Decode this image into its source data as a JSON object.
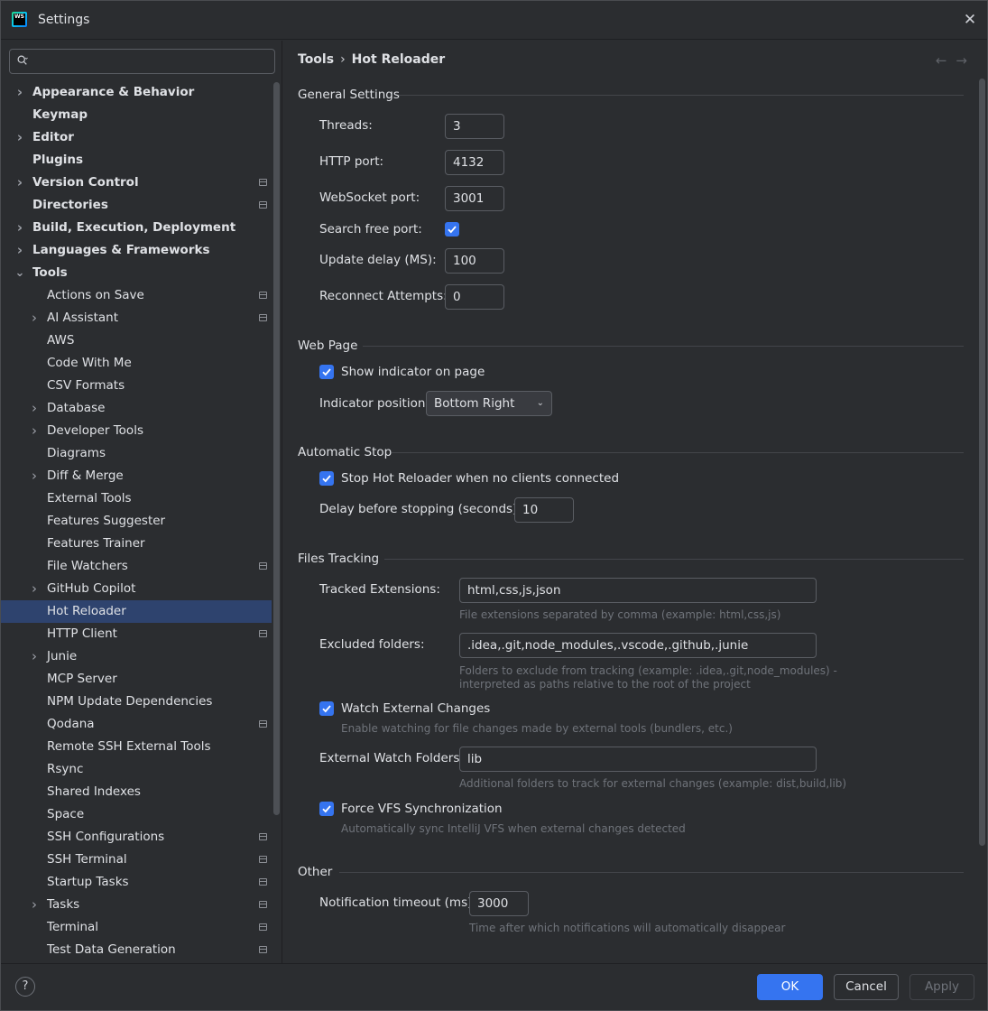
{
  "window": {
    "title": "Settings",
    "app_icon_text": "WS"
  },
  "sidebar": {
    "search": {
      "placeholder": ""
    },
    "items": [
      {
        "label": "Appearance & Behavior",
        "level": 0,
        "bold": true,
        "expandable": true,
        "expanded": false,
        "project": false
      },
      {
        "label": "Keymap",
        "level": 0,
        "bold": true,
        "expandable": false,
        "project": false
      },
      {
        "label": "Editor",
        "level": 0,
        "bold": true,
        "expandable": true,
        "expanded": false,
        "project": false
      },
      {
        "label": "Plugins",
        "level": 0,
        "bold": true,
        "expandable": false,
        "project": false
      },
      {
        "label": "Version Control",
        "level": 0,
        "bold": true,
        "expandable": true,
        "expanded": false,
        "project": true
      },
      {
        "label": "Directories",
        "level": 0,
        "bold": true,
        "expandable": false,
        "project": true
      },
      {
        "label": "Build, Execution, Deployment",
        "level": 0,
        "bold": true,
        "expandable": true,
        "expanded": false,
        "project": false
      },
      {
        "label": "Languages & Frameworks",
        "level": 0,
        "bold": true,
        "expandable": true,
        "expanded": false,
        "project": false
      },
      {
        "label": "Tools",
        "level": 0,
        "bold": true,
        "expandable": true,
        "expanded": true,
        "project": false
      },
      {
        "label": "Actions on Save",
        "level": 1,
        "expandable": false,
        "project": true
      },
      {
        "label": "AI Assistant",
        "level": 1,
        "expandable": true,
        "expanded": false,
        "project": true
      },
      {
        "label": "AWS",
        "level": 1,
        "expandable": false,
        "project": false
      },
      {
        "label": "Code With Me",
        "level": 1,
        "expandable": false,
        "project": false
      },
      {
        "label": "CSV Formats",
        "level": 1,
        "expandable": false,
        "project": false
      },
      {
        "label": "Database",
        "level": 1,
        "expandable": true,
        "expanded": false,
        "project": false
      },
      {
        "label": "Developer Tools",
        "level": 1,
        "expandable": true,
        "expanded": false,
        "project": false
      },
      {
        "label": "Diagrams",
        "level": 1,
        "expandable": false,
        "project": false
      },
      {
        "label": "Diff & Merge",
        "level": 1,
        "expandable": true,
        "expanded": false,
        "project": false
      },
      {
        "label": "External Tools",
        "level": 1,
        "expandable": false,
        "project": false
      },
      {
        "label": "Features Suggester",
        "level": 1,
        "expandable": false,
        "project": false
      },
      {
        "label": "Features Trainer",
        "level": 1,
        "expandable": false,
        "project": false
      },
      {
        "label": "File Watchers",
        "level": 1,
        "expandable": false,
        "project": true
      },
      {
        "label": "GitHub Copilot",
        "level": 1,
        "expandable": true,
        "expanded": false,
        "project": false
      },
      {
        "label": "Hot Reloader",
        "level": 1,
        "expandable": false,
        "project": false,
        "selected": true
      },
      {
        "label": "HTTP Client",
        "level": 1,
        "expandable": false,
        "project": true
      },
      {
        "label": "Junie",
        "level": 1,
        "expandable": true,
        "expanded": false,
        "project": false
      },
      {
        "label": "MCP Server",
        "level": 1,
        "expandable": false,
        "project": false
      },
      {
        "label": "NPM Update Dependencies",
        "level": 1,
        "expandable": false,
        "project": false
      },
      {
        "label": "Qodana",
        "level": 1,
        "expandable": false,
        "project": true
      },
      {
        "label": "Remote SSH External Tools",
        "level": 1,
        "expandable": false,
        "project": false
      },
      {
        "label": "Rsync",
        "level": 1,
        "expandable": false,
        "project": false
      },
      {
        "label": "Shared Indexes",
        "level": 1,
        "expandable": false,
        "project": false
      },
      {
        "label": "Space",
        "level": 1,
        "expandable": false,
        "project": false
      },
      {
        "label": "SSH Configurations",
        "level": 1,
        "expandable": false,
        "project": true
      },
      {
        "label": "SSH Terminal",
        "level": 1,
        "expandable": false,
        "project": true
      },
      {
        "label": "Startup Tasks",
        "level": 1,
        "expandable": false,
        "project": true
      },
      {
        "label": "Tasks",
        "level": 1,
        "expandable": true,
        "expanded": false,
        "project": true
      },
      {
        "label": "Terminal",
        "level": 1,
        "expandable": false,
        "project": true
      },
      {
        "label": "Test Data Generation",
        "level": 1,
        "expandable": false,
        "project": true
      }
    ]
  },
  "breadcrumb": {
    "parent": "Tools",
    "separator": "›",
    "current": "Hot Reloader"
  },
  "general": {
    "title": "General Settings",
    "threads_label": "Threads:",
    "threads_value": "3",
    "http_port_label": "HTTP port:",
    "http_port_value": "4132",
    "ws_port_label": "WebSocket port:",
    "ws_port_value": "3001",
    "search_free_port_label": "Search free port:",
    "search_free_port_checked": true,
    "update_delay_label": "Update delay (MS):",
    "update_delay_value": "100",
    "reconnect_label": "Reconnect Attempts:",
    "reconnect_value": "0"
  },
  "web_page": {
    "title": "Web Page",
    "show_indicator_label": "Show indicator on page",
    "show_indicator_checked": true,
    "indicator_position_label": "Indicator position:",
    "indicator_position_value": "Bottom Right"
  },
  "automatic_stop": {
    "title": "Automatic Stop",
    "stop_label": "Stop Hot Reloader when no clients connected",
    "stop_checked": true,
    "delay_label": "Delay before stopping (seconds):",
    "delay_value": "10"
  },
  "files_tracking": {
    "title": "Files Tracking",
    "tracked_ext_label": "Tracked Extensions:",
    "tracked_ext_value": "html,css,js,json",
    "tracked_ext_hint": "File extensions separated by comma (example: html,css,js)",
    "excluded_label": "Excluded folders:",
    "excluded_value": ".idea,.git,node_modules,.vscode,.github,.junie",
    "excluded_hint_1": "Folders to exclude from tracking (example: .idea,.git,node_modules) -",
    "excluded_hint_2": "interpreted as paths relative to the root of the project",
    "watch_external_label": "Watch External Changes",
    "watch_external_checked": true,
    "watch_external_hint": "Enable watching for file changes made by external tools (bundlers, etc.)",
    "ext_watch_folders_label": "External Watch Folders:",
    "ext_watch_folders_value": "lib",
    "ext_watch_folders_hint": "Additional folders to track for external changes (example: dist,build,lib)",
    "force_vfs_label": "Force VFS Synchronization",
    "force_vfs_checked": true,
    "force_vfs_hint": "Automatically sync IntelliJ VFS when external changes detected"
  },
  "other": {
    "title": "Other",
    "notification_timeout_label": "Notification timeout (ms):",
    "notification_timeout_value": "3000",
    "notification_timeout_hint": "Time after which notifications will automatically disappear"
  },
  "footer": {
    "help": "?",
    "ok": "OK",
    "cancel": "Cancel",
    "apply": "Apply"
  },
  "colors": {
    "accent": "#3574f0",
    "background": "#2b2d30",
    "selected": "#2e436e"
  }
}
